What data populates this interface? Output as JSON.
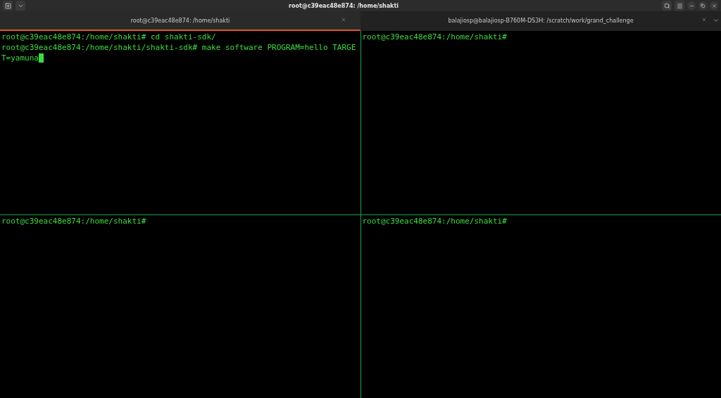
{
  "window": {
    "title": "root@c39eac48e874: /home/shakti"
  },
  "tabs": [
    {
      "label": "root@c39eac48e874: /home/shakti",
      "selected": true
    },
    {
      "label": "balajiosp@balajiosp-B760M-DS3H: /scratch/work/grand_challenge",
      "selected": false
    }
  ],
  "panes": [
    {
      "lines": [
        "root@c39eac48e874:/home/shakti# cd shakti-sdk/",
        "root@c39eac48e874:/home/shakti/shakti-sdk# make software PROGRAM=hello TARGE",
        "T=yamuna"
      ],
      "cursor": true
    },
    {
      "lines": [
        "root@c39eac48e874:/home/shakti#"
      ],
      "cursor": false
    },
    {
      "lines": [
        "root@c39eac48e874:/home/shakti#"
      ],
      "cursor": false
    },
    {
      "lines": [
        "root@c39eac48e874:/home/shakti#"
      ],
      "cursor": false
    }
  ]
}
